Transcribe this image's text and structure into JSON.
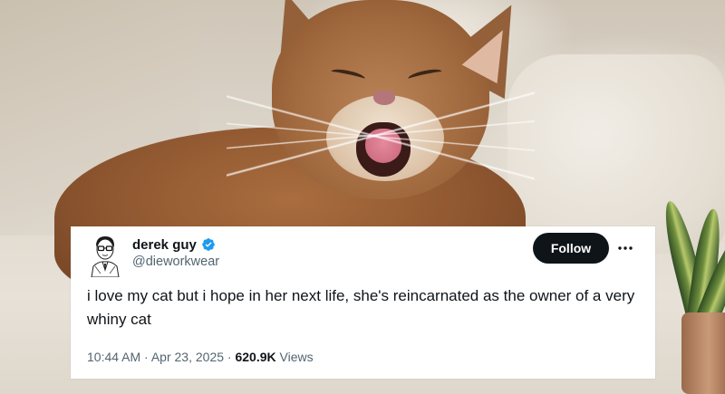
{
  "tweet": {
    "display_name": "derek guy",
    "handle": "@dieworkwear",
    "follow_label": "Follow",
    "more_label": "···",
    "text": "i love my cat but i hope in her next life, she's reincarnated as the owner of a very whiny cat",
    "time": "10:44 AM",
    "separator": "·",
    "date": "Apr 23, 2025",
    "views_count": "620.9K",
    "views_label": "Views",
    "verified_icon": "verified-badge-icon",
    "verified_color": "#1d9bf0"
  },
  "colors": {
    "card_background": "#ffffff",
    "primary_text": "#0f1419",
    "secondary_text": "#536471",
    "follow_button_bg": "#0f1419",
    "follow_button_text": "#ffffff"
  },
  "background_photo": {
    "subject": "cat-photo-icon"
  }
}
